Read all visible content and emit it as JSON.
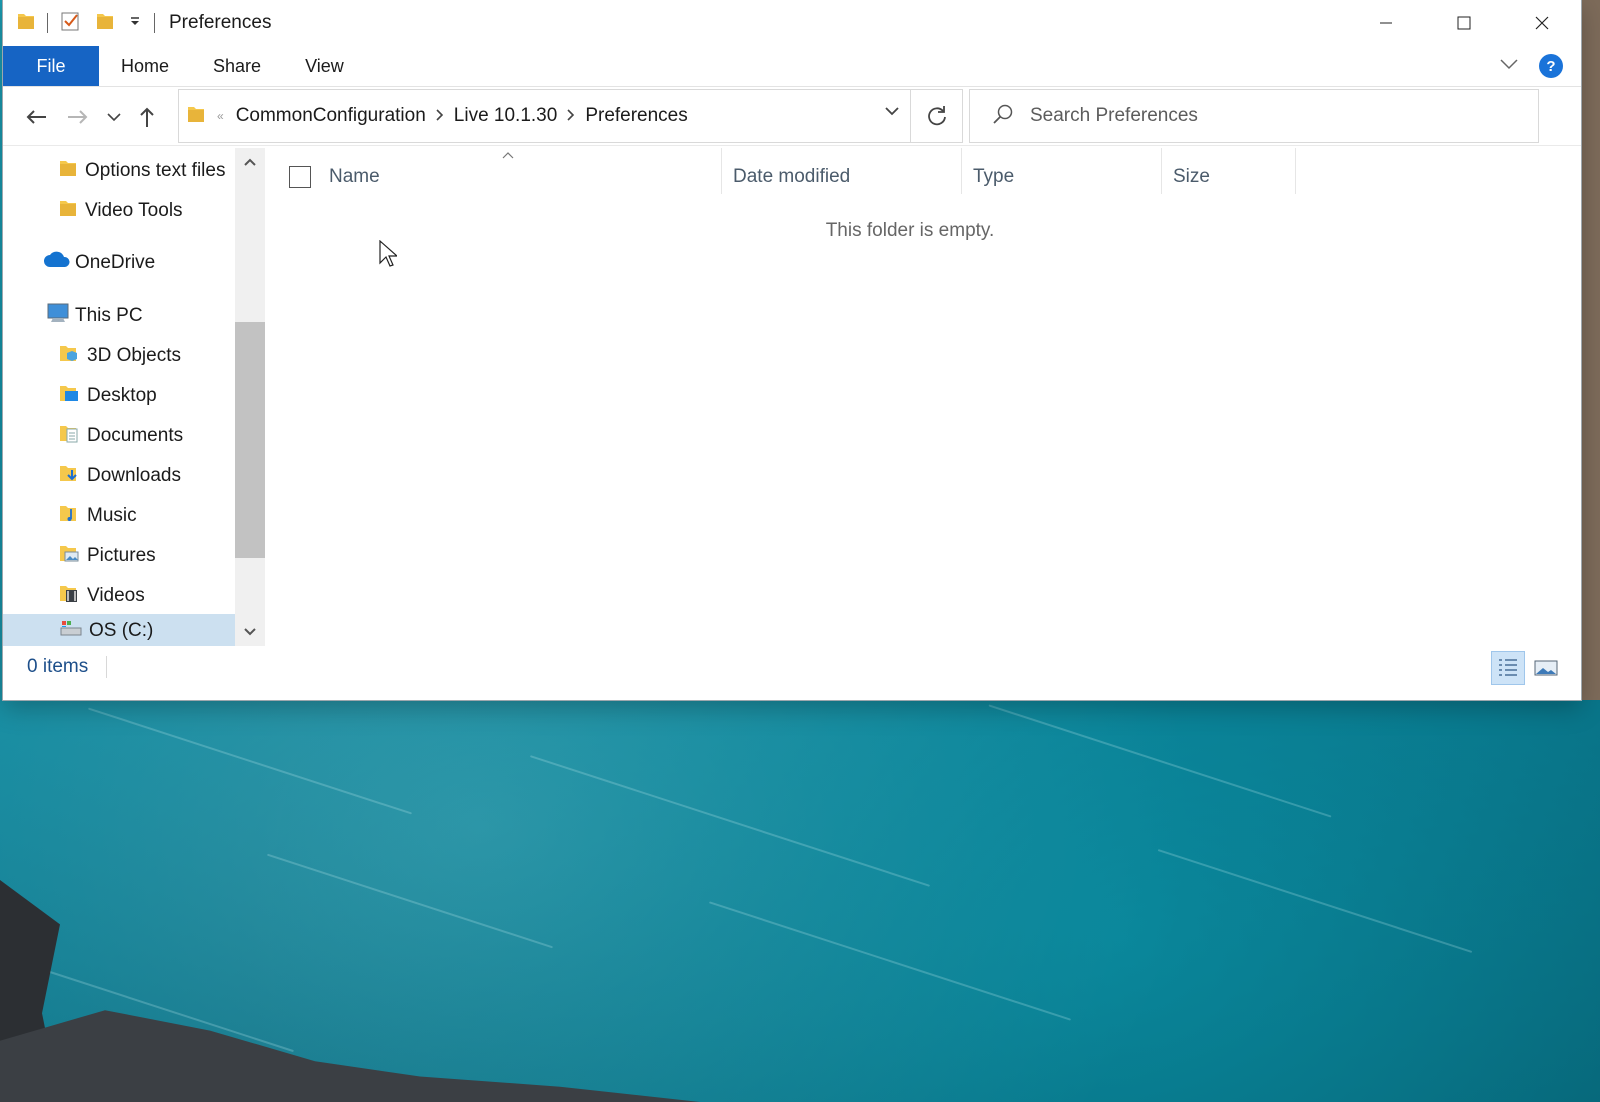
{
  "window": {
    "title": "Preferences"
  },
  "ribbon": {
    "tabs": [
      "File",
      "Home",
      "Share",
      "View"
    ],
    "help_label": "?"
  },
  "address": {
    "crumbs": [
      "CommonConfiguration",
      "Live 10.1.30",
      "Preferences"
    ]
  },
  "search": {
    "placeholder": "Search Preferences"
  },
  "nav_pane": {
    "items": [
      {
        "label": "Options text files",
        "icon": "folder-icon"
      },
      {
        "label": "Video Tools",
        "icon": "folder-icon"
      },
      {
        "label": "OneDrive",
        "icon": "onedrive-icon"
      },
      {
        "label": "This PC",
        "icon": "this-pc-icon"
      },
      {
        "label": "3D Objects",
        "icon": "3d-objects-icon"
      },
      {
        "label": "Desktop",
        "icon": "desktop-folder-icon"
      },
      {
        "label": "Documents",
        "icon": "documents-folder-icon"
      },
      {
        "label": "Downloads",
        "icon": "downloads-folder-icon"
      },
      {
        "label": "Music",
        "icon": "music-folder-icon"
      },
      {
        "label": "Pictures",
        "icon": "pictures-folder-icon"
      },
      {
        "label": "Videos",
        "icon": "videos-folder-icon"
      },
      {
        "label": "OS (C:)",
        "icon": "drive-icon"
      }
    ]
  },
  "content": {
    "columns": [
      "Name",
      "Date modified",
      "Type",
      "Size"
    ],
    "empty_message": "This folder is empty."
  },
  "status": {
    "item_count": "0 items"
  },
  "colors": {
    "accent": "#1664c4",
    "help": "#1a73d9",
    "folder": "#f5c84c",
    "selection": "#cce0f0"
  }
}
